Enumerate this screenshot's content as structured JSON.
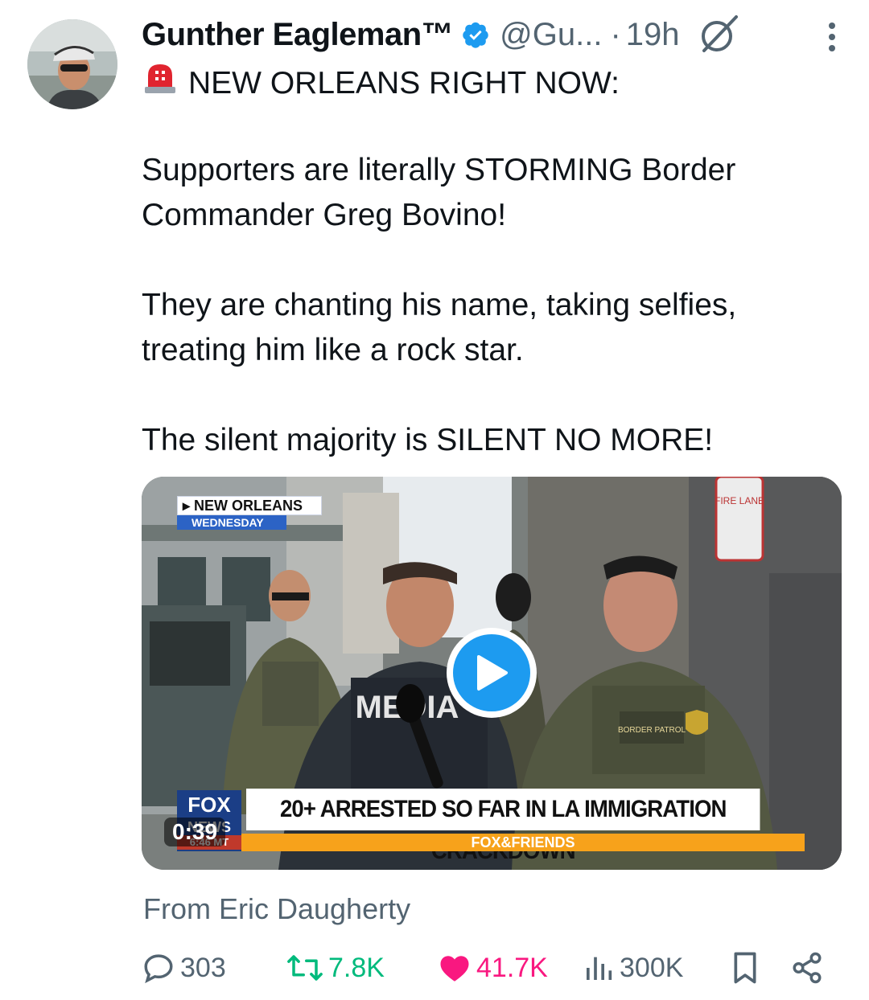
{
  "author": {
    "name": "Gunther Eagleman™",
    "handle": "@Gu...",
    "separator": "·",
    "time": "19h"
  },
  "post": {
    "line1": "NEW ORLEANS RIGHT NOW:",
    "para1_line1": "Supporters are literally STORMING Border",
    "para1_line2": "Commander Greg Bovino!",
    "para2_line1": "They are chanting his name, taking selfies,",
    "para2_line2": "treating him like a rock star.",
    "para3": "The silent majority is SILENT NO MORE!"
  },
  "video": {
    "location": "NEW ORLEANS",
    "day": "WEDNESDAY",
    "headline": "20+ ARRESTED SO FAR IN LA IMMIGRATION CRACKDOWN",
    "show": "FOX&FRIENDS",
    "network_top": "FOX",
    "network_bottom": "NEWS",
    "clock": "6:46 MT",
    "duration": "0:39",
    "vest_text": "MEDIA",
    "patch_text": "BORDER PATROL",
    "sign_text": "FIRE LANE"
  },
  "attribution": "From Eric Daugherty",
  "actions": {
    "replies": "303",
    "reposts": "7.8K",
    "likes": "41.7K",
    "views": "300K"
  },
  "colors": {
    "accent": "#1d9bf0",
    "like": "#f91880",
    "repost": "#00ba7c",
    "muted": "#536471"
  }
}
